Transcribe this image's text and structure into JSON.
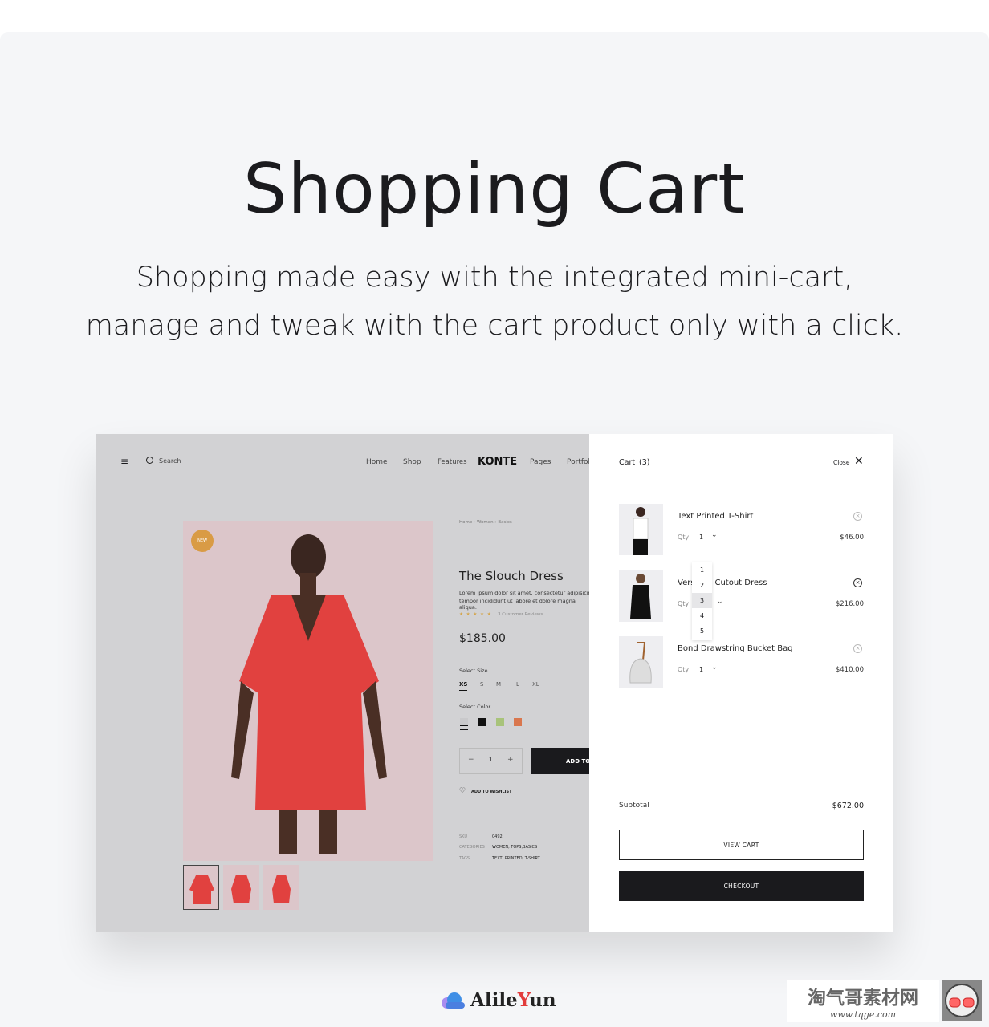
{
  "hero": {
    "title": "Shopping Cart",
    "subtitle_line1": "Shopping made easy with the integrated mini-cart,",
    "subtitle_line2": "manage and tweak with the cart product only with a click."
  },
  "header": {
    "search": "Search",
    "nav": [
      "Home",
      "Shop",
      "Features",
      "Pages",
      "Portfolio"
    ],
    "logo": "KONTE",
    "active": "Home"
  },
  "product": {
    "badge": "NEW",
    "breadcrumb": "Home  ›  Women  ›  Basics",
    "name": "The Slouch Dress",
    "desc1": "Lorem ipsum dolor sit amet, consectetur adipisicing eli",
    "desc2": "tempor incididunt ut labore et dolore magna aliqua.",
    "stars": "★ ★ ★ ★ ★",
    "reviews": "3 Customer Reviews",
    "rating": 4,
    "price": "$185.00",
    "size_label": "Select Size",
    "sizes": [
      "XS",
      "S",
      "M",
      "L",
      "XL"
    ],
    "selected_size": "XS",
    "color_label": "Select Color",
    "colors": [
      "#c9c9cb",
      "#111111",
      "#a8c37a",
      "#d9774e"
    ],
    "qty": "1",
    "minus": "−",
    "plus": "+",
    "add_to_cart": "ADD TO",
    "wishlist": "ADD TO WISHLIST",
    "meta": [
      {
        "k": "SKU",
        "v": "0492"
      },
      {
        "k": "CATEGORIES",
        "v": "WOMEN, TOPS,BASICS"
      },
      {
        "k": "TAGS",
        "v": "TEXT, PRINTED, T-SHIRT"
      }
    ]
  },
  "cart": {
    "title": "Cart",
    "count": "(3)",
    "close": "Close",
    "qty_label": "Qty",
    "items": [
      {
        "name": "Text Printed T-Shirt",
        "qty": "1",
        "price": "$46.00"
      },
      {
        "name": "Versatile Cutout Dress",
        "qty": "3",
        "price": "$216.00"
      },
      {
        "name": "Bond Drawstring Bucket Bag",
        "qty": "1",
        "price": "$410.00"
      }
    ],
    "qty_options": [
      "1",
      "2",
      "3",
      "4",
      "5"
    ],
    "subtotal_label": "Subtotal",
    "subtotal": "$672.00",
    "view_cart": "VIEW CART",
    "checkout": "CHECKOUT"
  },
  "watermarks": {
    "alileyun": "AlileYun",
    "tqge": "淘气哥素材网",
    "tqge_url": "www.tqge.com"
  }
}
